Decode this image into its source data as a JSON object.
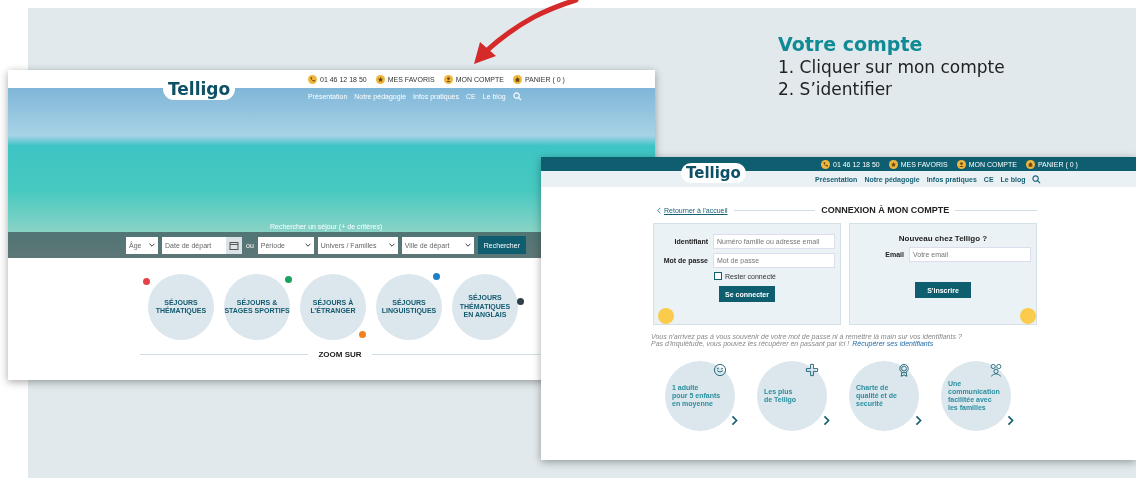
{
  "instructions": {
    "title": "Votre compte",
    "steps": [
      "1. Cliquer sur mon compte",
      "2. S’identifier"
    ]
  },
  "home_page": {
    "logo": "Telligo",
    "top_links": [
      {
        "kind": "phone",
        "label": "01 46 12 18 50"
      },
      {
        "kind": "star",
        "label": "MES FAVORIS"
      },
      {
        "kind": "account",
        "label": "MON COMPTE"
      },
      {
        "kind": "cart",
        "label": "PANIER ( 0 )"
      }
    ],
    "nav": [
      "Présentation",
      "Notre pédagogie",
      "Infos pratiques",
      "CE",
      "Le blog"
    ],
    "search_prompt": "Rechercher un séjour (+ de critères)",
    "filters": [
      {
        "kind": "select",
        "placeholder": "Âge"
      },
      {
        "kind": "date",
        "placeholder": "Date de départ"
      },
      {
        "kind": "separator",
        "label": "ou"
      },
      {
        "kind": "select",
        "placeholder": "Période"
      },
      {
        "kind": "select",
        "placeholder": "Univers / Familles"
      },
      {
        "kind": "select",
        "placeholder": "Ville de départ"
      }
    ],
    "search_button": "Rechercher",
    "categories": [
      {
        "lines": [
          "SÉJOURS",
          "THÉMATIQUES"
        ],
        "color": "#e5414b"
      },
      {
        "lines": [
          "SÉJOURS &",
          "STAGES SPORTIFS"
        ],
        "color": "#1aa260"
      },
      {
        "lines": [
          "SÉJOURS À",
          "L’ÉTRANGER"
        ],
        "color": "#f07f1e"
      },
      {
        "lines": [
          "SÉJOURS",
          "LINGUISTIQUES"
        ],
        "color": "#1f7fc6"
      },
      {
        "lines": [
          "SÉJOURS",
          "THÉMATIQUES",
          "EN ANGLAIS"
        ],
        "color": "#2f3f4a"
      }
    ],
    "section_title": "ZOOM SUR"
  },
  "login_page": {
    "logo": "Telligo",
    "top_links": [
      {
        "kind": "phone",
        "label": "01 46 12 18 50"
      },
      {
        "kind": "star",
        "label": "MES FAVORIS"
      },
      {
        "kind": "account",
        "label": "MON COMPTE"
      },
      {
        "kind": "cart",
        "label": "PANIER ( 0 )"
      }
    ],
    "nav": [
      "Présentation",
      "Notre pédagogie",
      "Infos pratiques",
      "CE",
      "Le blog"
    ],
    "back_link": "Retourner à l'accueil",
    "title": "CONNEXION À MON COMPTE",
    "login_fields": [
      {
        "label": "Identifiant",
        "placeholder": "Numéro famille ou adresse email"
      },
      {
        "label": "Mot de passe",
        "placeholder": "Mot de passe"
      }
    ],
    "remember": {
      "label": "Rester connecté",
      "checked": false
    },
    "login_button": "Se connecter",
    "register_title": "Nouveau chez Telligo ?",
    "register_field": {
      "label": "Email",
      "placeholder": "Votre email"
    },
    "register_button": "S'inscrire",
    "help_lines": [
      "Vous n'arrivez pas à vous souvenir de votre mot de passe ni à remettre là main sur vos identifiants ?",
      "Pas d'inquiétude, vous pouvez les récupérer en passant par ici !"
    ],
    "help_link": "Récupérer ses identifiants",
    "features": [
      {
        "kind": "smile",
        "lines": [
          "1 adulte",
          "pour 5 enfants",
          "en moyenne"
        ]
      },
      {
        "kind": "plus",
        "lines": [
          "Les plus",
          "de Telligo"
        ]
      },
      {
        "kind": "medal",
        "lines": [
          "Charte de",
          "qualité et de",
          "securité"
        ]
      },
      {
        "kind": "family",
        "lines": [
          "Une",
          "communication",
          "facilitée avec",
          "les familles"
        ]
      }
    ]
  }
}
